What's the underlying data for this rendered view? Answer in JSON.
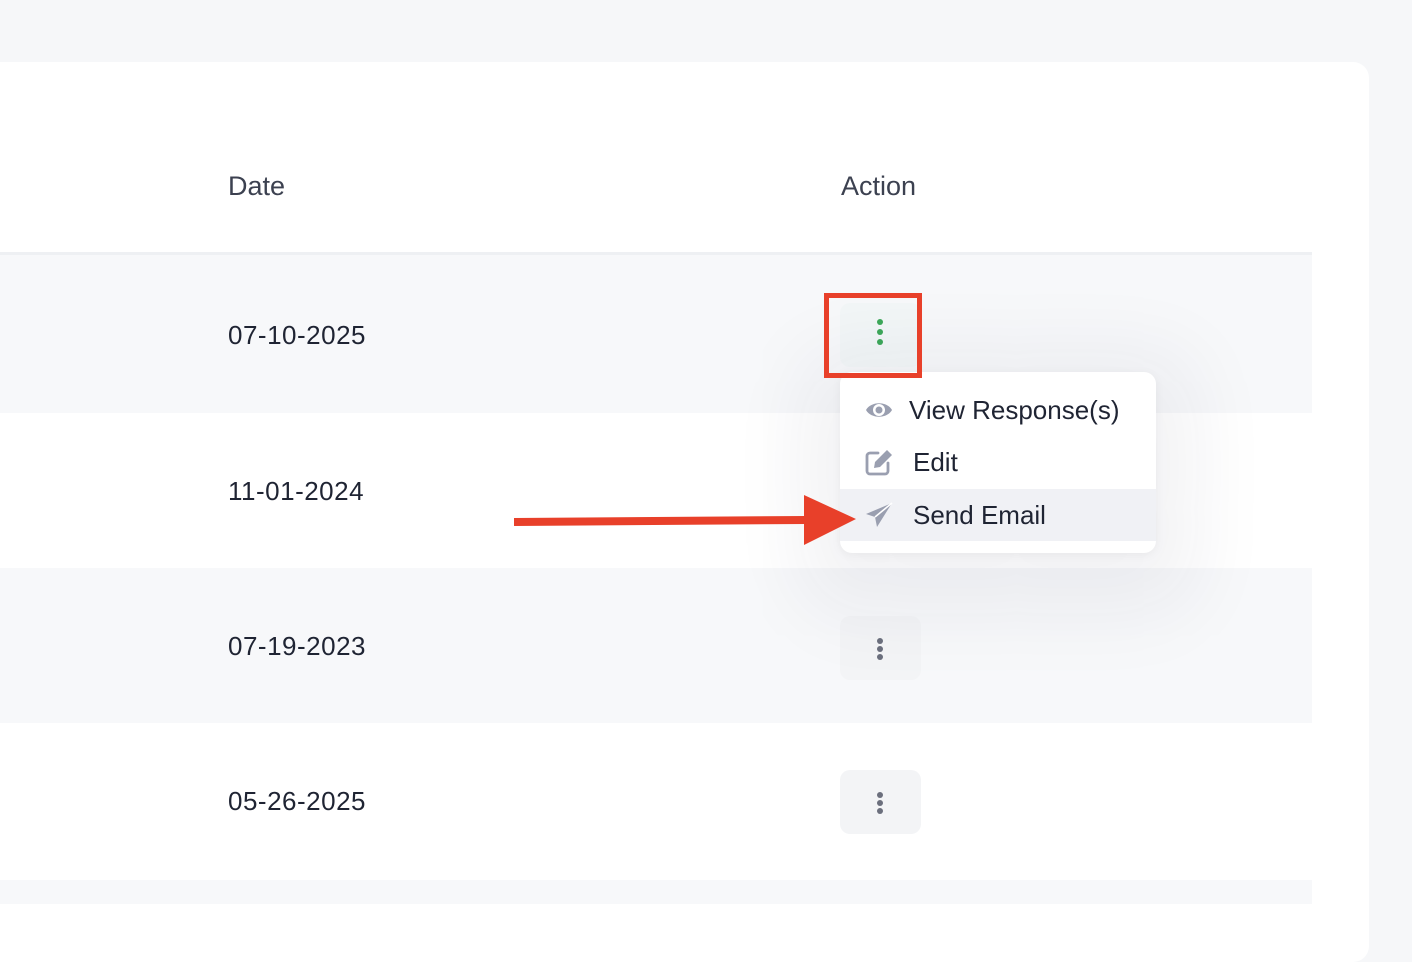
{
  "table": {
    "headers": {
      "date": "Date",
      "action": "Action"
    },
    "rows": [
      {
        "date": "07-10-2025"
      },
      {
        "date": "11-01-2024"
      },
      {
        "date": "07-19-2023"
      },
      {
        "date": "05-26-2025"
      }
    ]
  },
  "action_menu": {
    "items": [
      {
        "label": "View Response(s)",
        "icon": "eye-icon"
      },
      {
        "label": "Edit",
        "icon": "edit-icon"
      },
      {
        "label": "Send Email",
        "icon": "send-icon"
      }
    ],
    "hovered_item": "Send Email"
  },
  "icons": {
    "kebab": "kebab-menu-icon"
  },
  "colors": {
    "highlight": "#e8402a",
    "active_dots": "#3da85a",
    "menu_hover": "#f0f1f5",
    "icon_gray": "#9a9fb0"
  }
}
